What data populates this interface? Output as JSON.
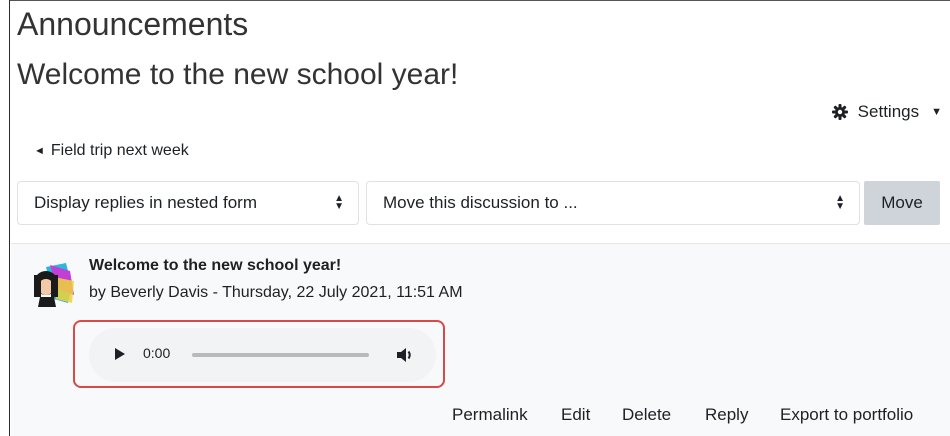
{
  "page": {
    "heading": "Announcements",
    "discussion_title": "Welcome to the new school year!"
  },
  "settings": {
    "label": "Settings",
    "icon": "gear-icon"
  },
  "navigation": {
    "previous_discussion": "Field trip next week"
  },
  "controls": {
    "display_mode": "Display replies in nested form",
    "move_target": "Move this discussion to ...",
    "move_button": "Move"
  },
  "post": {
    "subject": "Welcome to the new school year!",
    "byline": "by Beverly Davis - Thursday, 22 July 2021, 11:51 AM",
    "audio": {
      "time": "0:00",
      "progress": 0
    },
    "actions": [
      "Permalink",
      "Edit",
      "Delete",
      "Reply",
      "Export to portfolio"
    ]
  },
  "colors": {
    "highlight_border": "#d84a4a",
    "post_background": "#f8f9fa",
    "move_button": "#ced4da"
  }
}
